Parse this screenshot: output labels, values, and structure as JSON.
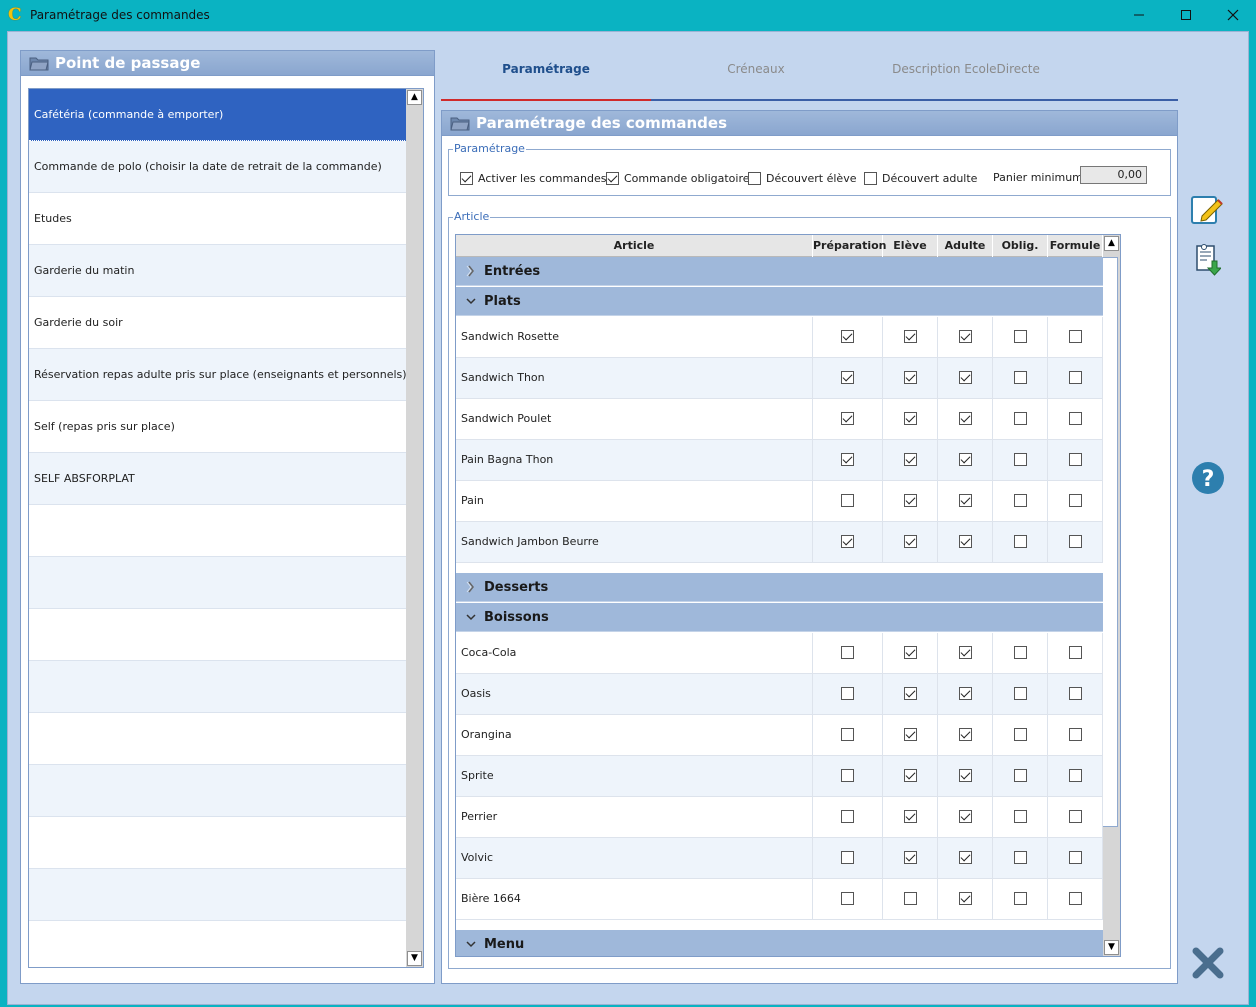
{
  "window": {
    "title": "Paramétrage des commandes",
    "controls": {
      "minimize": "minimize-icon",
      "maximize": "maximize-icon",
      "close": "close-icon"
    }
  },
  "left_panel": {
    "title": "Point de passage",
    "items": [
      {
        "label": "Cafétéria (commande à emporter)",
        "selected": true
      },
      {
        "label": "Commande de polo (choisir la date de retrait de la commande)"
      },
      {
        "label": "Etudes"
      },
      {
        "label": "Garderie du matin"
      },
      {
        "label": "Garderie du soir"
      },
      {
        "label": "Réservation repas adulte pris sur place (enseignants et personnels)"
      },
      {
        "label": "Self (repas pris sur place)"
      },
      {
        "label": "SELF ABSFORPLAT"
      }
    ]
  },
  "tabs": [
    {
      "label": "Paramétrage",
      "active": true
    },
    {
      "label": "Créneaux"
    },
    {
      "label": "Description EcoleDirecte"
    }
  ],
  "right_panel": {
    "title": "Paramétrage des commandes",
    "settings_legend": "Paramétrage",
    "options": [
      {
        "label": "Activer les commandes",
        "checked": true
      },
      {
        "label": "Commande obligatoire",
        "checked": true
      },
      {
        "label": "Découvert élève",
        "checked": false
      },
      {
        "label": "Découvert adulte",
        "checked": false
      }
    ],
    "panier_label": "Panier minimum",
    "panier_value": "0,00",
    "article_legend": "Article",
    "columns": [
      "Article",
      "Préparation",
      "Elève",
      "Adulte",
      "Oblig.",
      "Formule"
    ],
    "groups": [
      {
        "name": "Entrées",
        "expanded": false,
        "rows": []
      },
      {
        "name": "Plats",
        "expanded": true,
        "rows": [
          {
            "name": "Sandwich Rosette",
            "checks": [
              true,
              true,
              true,
              false,
              false
            ]
          },
          {
            "name": "Sandwich Thon",
            "checks": [
              true,
              true,
              true,
              false,
              false
            ]
          },
          {
            "name": "Sandwich Poulet",
            "checks": [
              true,
              true,
              true,
              false,
              false
            ]
          },
          {
            "name": "Pain Bagna Thon",
            "checks": [
              true,
              true,
              true,
              false,
              false
            ]
          },
          {
            "name": "Pain",
            "checks": [
              false,
              true,
              true,
              false,
              false
            ]
          },
          {
            "name": "Sandwich Jambon Beurre",
            "checks": [
              true,
              true,
              true,
              false,
              false
            ]
          }
        ]
      },
      {
        "name": "Desserts",
        "expanded": false,
        "rows": []
      },
      {
        "name": "Boissons",
        "expanded": true,
        "rows": [
          {
            "name": "Coca-Cola",
            "checks": [
              false,
              true,
              true,
              false,
              false
            ]
          },
          {
            "name": "Oasis",
            "checks": [
              false,
              true,
              true,
              false,
              false
            ]
          },
          {
            "name": "Orangina",
            "checks": [
              false,
              true,
              true,
              false,
              false
            ]
          },
          {
            "name": "Sprite",
            "checks": [
              false,
              true,
              true,
              false,
              false
            ]
          },
          {
            "name": "Perrier",
            "checks": [
              false,
              true,
              true,
              false,
              false
            ]
          },
          {
            "name": "Volvic",
            "checks": [
              false,
              true,
              true,
              false,
              false
            ]
          },
          {
            "name": "Bière 1664",
            "checks": [
              false,
              false,
              true,
              false,
              false
            ]
          }
        ]
      },
      {
        "name": "Menu",
        "expanded": true,
        "rows": []
      }
    ]
  },
  "side_actions": [
    "edit-icon",
    "export-icon",
    "help-icon",
    "close-x-icon"
  ],
  "colors": {
    "titlebar": "#0ab3c2",
    "panel_header": "#9fb8da",
    "selection": "#2f63c1",
    "active_tab_line": "#d02b2b",
    "help": "#2d7fae",
    "close_x": "#4a6e8e"
  }
}
